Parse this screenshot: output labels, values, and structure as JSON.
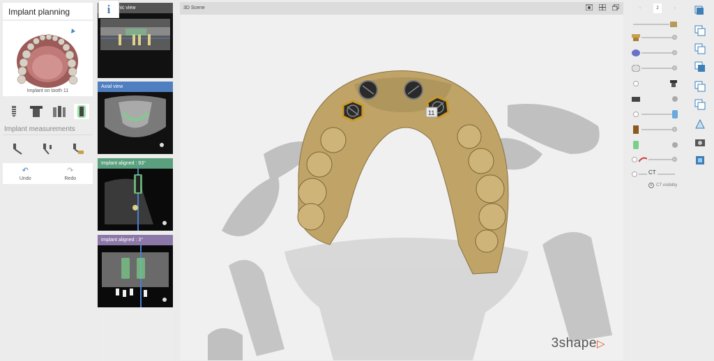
{
  "left_panel": {
    "title": "Implant planning",
    "caption": "Implant on tooth 11",
    "section_label": "Implant measurements",
    "undo_label": "Undo",
    "redo_label": "Redo"
  },
  "info_icon": "i",
  "thumbnails": [
    {
      "label": "Panoramic view",
      "header_color": "#555555"
    },
    {
      "label": "Axial view",
      "header_color": "#4f7fc0"
    },
    {
      "label": "Implant aligned : 93°",
      "header_color": "#5aa07e"
    },
    {
      "label": "Implant aligned : 3°",
      "header_color": "#8b78a8"
    }
  ],
  "scene": {
    "title": "3D Scene",
    "tooth_tag": "11",
    "brand": "3shape"
  },
  "right_panel": {
    "page_current": "2",
    "ct_slider_label": "CT",
    "ct_visibility_label": "CT visibility"
  },
  "colors": {
    "gold": "#c7a866",
    "implant_gold": "#c99a2a",
    "implant_dark": "#2a2a2a",
    "brand_accent": "#e0502a",
    "icon_blue": "#3d80b8"
  }
}
